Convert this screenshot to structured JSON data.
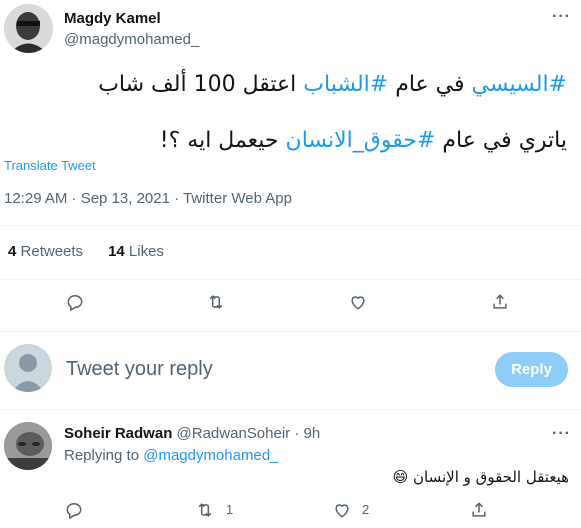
{
  "tweet": {
    "author_name": "Magdy Kamel",
    "author_handle": "@magdymohamed_",
    "line1_hash1": "#السيسي",
    "line1_mid": " في عام ",
    "line1_hash2": "#الشباب",
    "line1_rest": " اعتقل 100 ألف شاب",
    "line2_start": "ياتري في عام ",
    "line2_hash": "#حقوق_الانسان",
    "line2_rest": " حيعمل ايه ؟!",
    "translate_label": "Translate Tweet",
    "timestamp": "12:29 AM · Sep 13, 2021 · Twitter Web App",
    "retweets_count": "4",
    "retweets_label": "Retweets",
    "likes_count": "14",
    "likes_label": "Likes",
    "more_label": "···"
  },
  "composer": {
    "placeholder": "Tweet your reply",
    "reply_button": "Reply"
  },
  "reply": {
    "author_name": "Soheir Radwan",
    "author_handle": "@RadwanSoheir",
    "time": " · 9h",
    "replying_prefix": "Replying to ",
    "replying_to": "@magdymohamed_",
    "text": "هيعتقل الحقوق و الإنسان",
    "emoji": "😄",
    "retweet_count": "1",
    "like_count": "2",
    "more_label": "···"
  },
  "icons": {
    "reply": "reply-icon",
    "retweet": "retweet-icon",
    "like": "heart-icon",
    "share": "share-icon"
  },
  "colors": {
    "accent": "#1d9bf0",
    "muted": "#536471",
    "reply_button_bg": "#8ecdf8"
  }
}
